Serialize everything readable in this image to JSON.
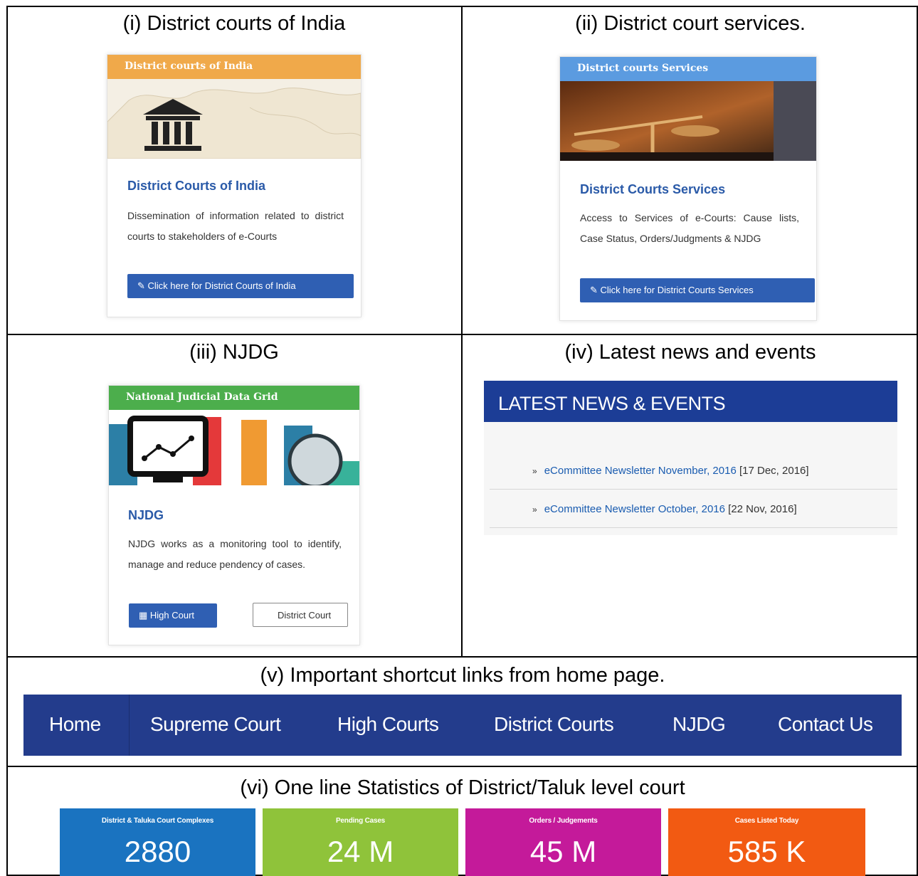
{
  "captions": {
    "c1": "(i) District courts of India",
    "c2": "(ii) District court services.",
    "c3": "(iii) NJDG",
    "c4": "(iv) Latest news and events",
    "c5": "(v) Important shortcut links from home page.",
    "c6": "(vi) One line Statistics of District/Taluk level court"
  },
  "card1": {
    "header": "District courts of India",
    "title": "District Courts of India",
    "text": "Dissemination of information related to district courts to stakeholders of e-Courts",
    "button": "Click here for District Courts of India",
    "header_color": "#f0a94a"
  },
  "card2": {
    "header": "District courts Services",
    "title": "District Courts Services",
    "text": "Access to Services of e-Courts: Cause lists, Case Status, Orders/Judgments & NJDG",
    "button": "Click here for District Courts Services",
    "header_color": "#5b9be0"
  },
  "card3": {
    "header": "National Judicial Data Grid",
    "title": "NJDG",
    "text": "NJDG works as a monitoring tool to identify, manage and reduce pendency of cases.",
    "button_high": "High Court",
    "button_district": "District Court",
    "header_color": "#4cae4c"
  },
  "news": {
    "heading": "LATEST NEWS & EVENTS",
    "items": [
      {
        "link": "eCommittee Newsletter November, 2016",
        "date": "[17 Dec, 2016]"
      },
      {
        "link": "eCommittee Newsletter October, 2016",
        "date": "[22 Nov, 2016]"
      }
    ]
  },
  "nav": {
    "items": [
      "Home",
      "Supreme Court",
      "High Courts",
      "District Courts",
      "NJDG",
      "Contact Us"
    ],
    "color": "#233c8c"
  },
  "stats": [
    {
      "label": "District & Taluka Court Complexes",
      "value": "2880",
      "color": "#1a73c0"
    },
    {
      "label": "Pending Cases",
      "value": "24 M",
      "color": "#8fc33a"
    },
    {
      "label": "Orders / Judgements",
      "value": "45 M",
      "color": "#c41a9a"
    },
    {
      "label": "Cases Listed Today",
      "value": "585 K",
      "color": "#f25a12"
    }
  ]
}
